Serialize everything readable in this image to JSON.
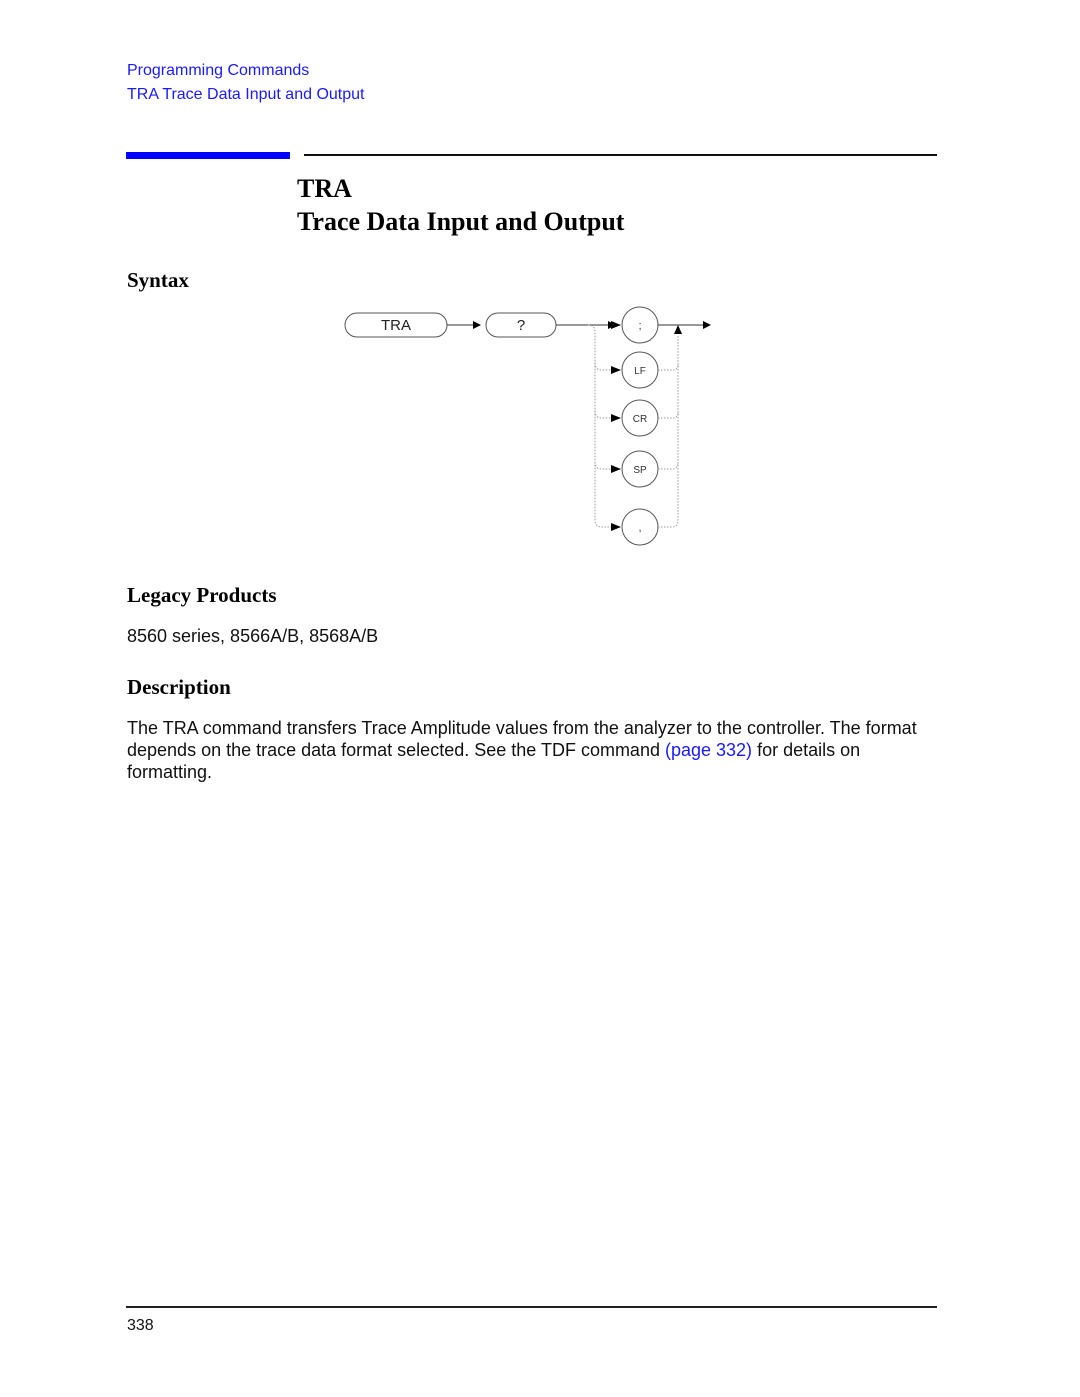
{
  "breadcrumb": {
    "items": [
      "Programming Commands",
      "TRA Trace Data Input and Output"
    ]
  },
  "title": {
    "code": "TRA",
    "name": "Trace Data Input and Output"
  },
  "sections": {
    "syntax": "Syntax",
    "legacy": "Legacy Products",
    "description": "Description"
  },
  "syntax_diagram": {
    "command": "TRA",
    "query": "?",
    "terminators": [
      ";",
      "LF",
      "CR",
      "SP",
      ","
    ]
  },
  "legacy_products": "8560 series, 8566A/B, 8568A/B",
  "description": {
    "before_link": "The TRA command transfers Trace Amplitude values from the analyzer to the controller. The format depends on the trace data format selected. See the TDF command ",
    "link_text": "(page 332)",
    "after_link": " for details on formatting."
  },
  "footer": {
    "page_number": "338"
  },
  "colors": {
    "link": "#1a1aff",
    "accent_bar": "#0000ff"
  }
}
